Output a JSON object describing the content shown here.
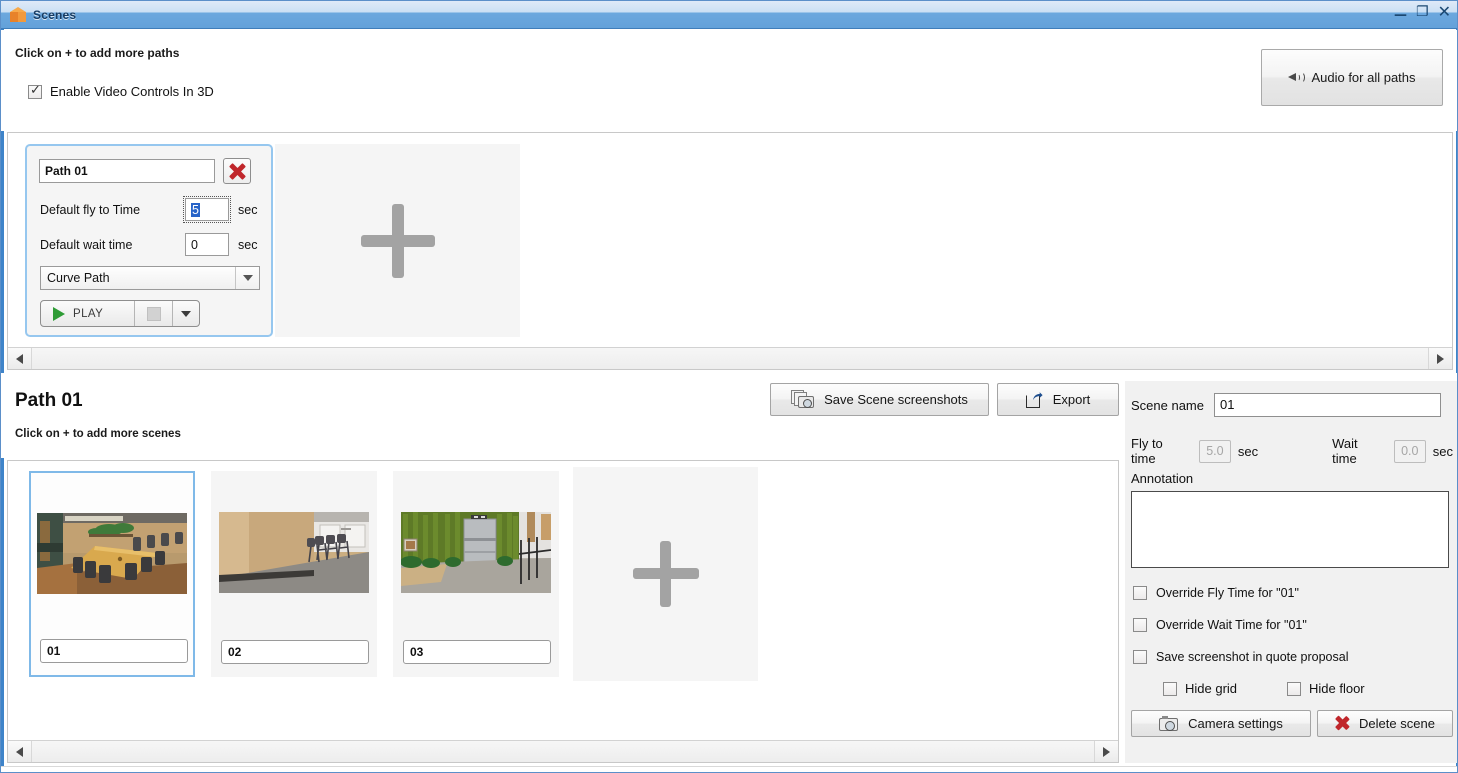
{
  "window": {
    "title": "Scenes",
    "app_icon": "orange-box-icon",
    "controls": {
      "minimize": "—",
      "maximize": "❐",
      "close": "✕"
    }
  },
  "top": {
    "hint": "Click on + to add more paths",
    "enable_video_controls": {
      "label": "Enable Video Controls In 3D",
      "checked": true
    },
    "audio_button": {
      "label": "Audio for all paths",
      "icon": "speaker-icon"
    }
  },
  "path_card": {
    "name_value": "Path 01",
    "delete_icon": "red-x-icon",
    "fly_label": "Default fly to Time",
    "fly_value": "5",
    "fly_unit": "sec",
    "wait_label": "Default wait time",
    "wait_value": "0",
    "wait_unit": "sec",
    "path_type": "Curve Path",
    "play_label": "PLAY",
    "stop_label": "",
    "dropdown_label": ""
  },
  "add_path": {
    "label": "+"
  },
  "middle": {
    "path_title": "Path 01",
    "hint": "Click on + to add more scenes",
    "save_screenshots_label": "Save Scene screenshots",
    "export_label": "Export"
  },
  "scenes": [
    {
      "name": "01",
      "selected": true,
      "thumb": "conference-room-thumbnail"
    },
    {
      "name": "02",
      "selected": false,
      "thumb": "chairs-room-thumbnail"
    },
    {
      "name": "03",
      "selected": false,
      "thumb": "green-wall-elevator-thumbnail"
    }
  ],
  "add_scene": {
    "label": "+"
  },
  "right_panel": {
    "scene_name_label": "Scene name",
    "scene_name_value": "01",
    "fly_to_time_label": "Fly to time",
    "fly_to_time_value": "5.0",
    "fly_to_time_unit": "sec",
    "wait_time_label": "Wait time",
    "wait_time_value": "0.0",
    "wait_time_unit": "sec",
    "annotation_label": "Annotation",
    "annotation_value": "",
    "checkboxes": [
      {
        "label": "Override Fly Time for \"01\"",
        "checked": false
      },
      {
        "label": "Override Wait Time for \"01\"",
        "checked": false
      },
      {
        "label": "Save screenshot in quote proposal",
        "checked": false
      },
      {
        "label": "Hide grid",
        "checked": false
      },
      {
        "label": "Hide floor",
        "checked": false
      }
    ],
    "camera_settings_label": "Camera settings",
    "delete_scene_label": "Delete scene"
  },
  "colors": {
    "titlebar_blue": "#63a1da",
    "frame_blue": "#3f84c9",
    "selection_blue": "#2864c8",
    "card_border_blue": "#96c7ef",
    "red_x": "#c0262b",
    "play_green": "#2e9b35",
    "panel_gray": "#f1f1f1"
  }
}
